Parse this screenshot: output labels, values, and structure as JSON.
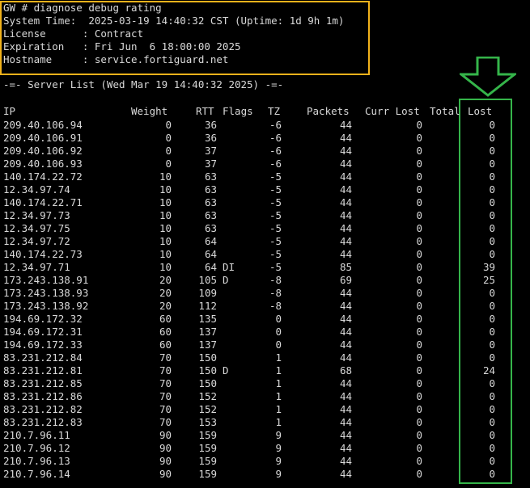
{
  "header": {
    "command_line": "GW # diagnose debug rating",
    "system_time": "System Time:  2025-03-19 14:40:32 CST (Uptime: 1d 9h 1m)",
    "license": "License      : Contract",
    "expiration": "Expiration   : Fri Jun  6 18:00:00 2025",
    "hostname": "Hostname     : service.fortiguard.net"
  },
  "server_list_title": "-=- Server List (Wed Mar 19 14:40:32 2025) -=-",
  "columns": {
    "ip": "IP",
    "weight": "Weight",
    "rtt": "RTT",
    "flags": "Flags",
    "tz": "TZ",
    "packets": "Packets",
    "curr_lost": "Curr Lost",
    "total": "Total",
    "lost": "Lost"
  },
  "rows": [
    {
      "ip": "209.40.106.94",
      "weight": "0",
      "rtt": "36",
      "flags": "",
      "tz": "-6",
      "packets": "44",
      "curr_lost": "0",
      "total_lost": "0"
    },
    {
      "ip": "209.40.106.91",
      "weight": "0",
      "rtt": "36",
      "flags": "",
      "tz": "-6",
      "packets": "44",
      "curr_lost": "0",
      "total_lost": "0"
    },
    {
      "ip": "209.40.106.92",
      "weight": "0",
      "rtt": "37",
      "flags": "",
      "tz": "-6",
      "packets": "44",
      "curr_lost": "0",
      "total_lost": "0"
    },
    {
      "ip": "209.40.106.93",
      "weight": "0",
      "rtt": "37",
      "flags": "",
      "tz": "-6",
      "packets": "44",
      "curr_lost": "0",
      "total_lost": "0"
    },
    {
      "ip": "140.174.22.72",
      "weight": "10",
      "rtt": "63",
      "flags": "",
      "tz": "-5",
      "packets": "44",
      "curr_lost": "0",
      "total_lost": "0"
    },
    {
      "ip": "12.34.97.74",
      "weight": "10",
      "rtt": "63",
      "flags": "",
      "tz": "-5",
      "packets": "44",
      "curr_lost": "0",
      "total_lost": "0"
    },
    {
      "ip": "140.174.22.71",
      "weight": "10",
      "rtt": "63",
      "flags": "",
      "tz": "-5",
      "packets": "44",
      "curr_lost": "0",
      "total_lost": "0"
    },
    {
      "ip": "12.34.97.73",
      "weight": "10",
      "rtt": "63",
      "flags": "",
      "tz": "-5",
      "packets": "44",
      "curr_lost": "0",
      "total_lost": "0"
    },
    {
      "ip": "12.34.97.75",
      "weight": "10",
      "rtt": "63",
      "flags": "",
      "tz": "-5",
      "packets": "44",
      "curr_lost": "0",
      "total_lost": "0"
    },
    {
      "ip": "12.34.97.72",
      "weight": "10",
      "rtt": "64",
      "flags": "",
      "tz": "-5",
      "packets": "44",
      "curr_lost": "0",
      "total_lost": "0"
    },
    {
      "ip": "140.174.22.73",
      "weight": "10",
      "rtt": "64",
      "flags": "",
      "tz": "-5",
      "packets": "44",
      "curr_lost": "0",
      "total_lost": "0"
    },
    {
      "ip": "12.34.97.71",
      "weight": "10",
      "rtt": "64",
      "flags": "DI",
      "tz": "-5",
      "packets": "85",
      "curr_lost": "0",
      "total_lost": "39"
    },
    {
      "ip": "173.243.138.91",
      "weight": "20",
      "rtt": "105",
      "flags": "D",
      "tz": "-8",
      "packets": "69",
      "curr_lost": "0",
      "total_lost": "25"
    },
    {
      "ip": "173.243.138.93",
      "weight": "20",
      "rtt": "109",
      "flags": "",
      "tz": "-8",
      "packets": "44",
      "curr_lost": "0",
      "total_lost": "0"
    },
    {
      "ip": "173.243.138.92",
      "weight": "20",
      "rtt": "112",
      "flags": "",
      "tz": "-8",
      "packets": "44",
      "curr_lost": "0",
      "total_lost": "0"
    },
    {
      "ip": "194.69.172.32",
      "weight": "60",
      "rtt": "135",
      "flags": "",
      "tz": "0",
      "packets": "44",
      "curr_lost": "0",
      "total_lost": "0"
    },
    {
      "ip": "194.69.172.31",
      "weight": "60",
      "rtt": "137",
      "flags": "",
      "tz": "0",
      "packets": "44",
      "curr_lost": "0",
      "total_lost": "0"
    },
    {
      "ip": "194.69.172.33",
      "weight": "60",
      "rtt": "137",
      "flags": "",
      "tz": "0",
      "packets": "44",
      "curr_lost": "0",
      "total_lost": "0"
    },
    {
      "ip": "83.231.212.84",
      "weight": "70",
      "rtt": "150",
      "flags": "",
      "tz": "1",
      "packets": "44",
      "curr_lost": "0",
      "total_lost": "0"
    },
    {
      "ip": "83.231.212.81",
      "weight": "70",
      "rtt": "150",
      "flags": "D",
      "tz": "1",
      "packets": "68",
      "curr_lost": "0",
      "total_lost": "24"
    },
    {
      "ip": "83.231.212.85",
      "weight": "70",
      "rtt": "150",
      "flags": "",
      "tz": "1",
      "packets": "44",
      "curr_lost": "0",
      "total_lost": "0"
    },
    {
      "ip": "83.231.212.86",
      "weight": "70",
      "rtt": "152",
      "flags": "",
      "tz": "1",
      "packets": "44",
      "curr_lost": "0",
      "total_lost": "0"
    },
    {
      "ip": "83.231.212.82",
      "weight": "70",
      "rtt": "152",
      "flags": "",
      "tz": "1",
      "packets": "44",
      "curr_lost": "0",
      "total_lost": "0"
    },
    {
      "ip": "83.231.212.83",
      "weight": "70",
      "rtt": "153",
      "flags": "",
      "tz": "1",
      "packets": "44",
      "curr_lost": "0",
      "total_lost": "0"
    },
    {
      "ip": "210.7.96.11",
      "weight": "90",
      "rtt": "159",
      "flags": "",
      "tz": "9",
      "packets": "44",
      "curr_lost": "0",
      "total_lost": "0"
    },
    {
      "ip": "210.7.96.12",
      "weight": "90",
      "rtt": "159",
      "flags": "",
      "tz": "9",
      "packets": "44",
      "curr_lost": "0",
      "total_lost": "0"
    },
    {
      "ip": "210.7.96.13",
      "weight": "90",
      "rtt": "159",
      "flags": "",
      "tz": "9",
      "packets": "44",
      "curr_lost": "0",
      "total_lost": "0"
    },
    {
      "ip": "210.7.96.14",
      "weight": "90",
      "rtt": "159",
      "flags": "",
      "tz": "9",
      "packets": "44",
      "curr_lost": "0",
      "total_lost": "0"
    }
  ],
  "colors": {
    "background": "#000000",
    "text": "#d9d9d9",
    "header_highlight": "#f2b21b",
    "lost_highlight": "#35b54a"
  }
}
